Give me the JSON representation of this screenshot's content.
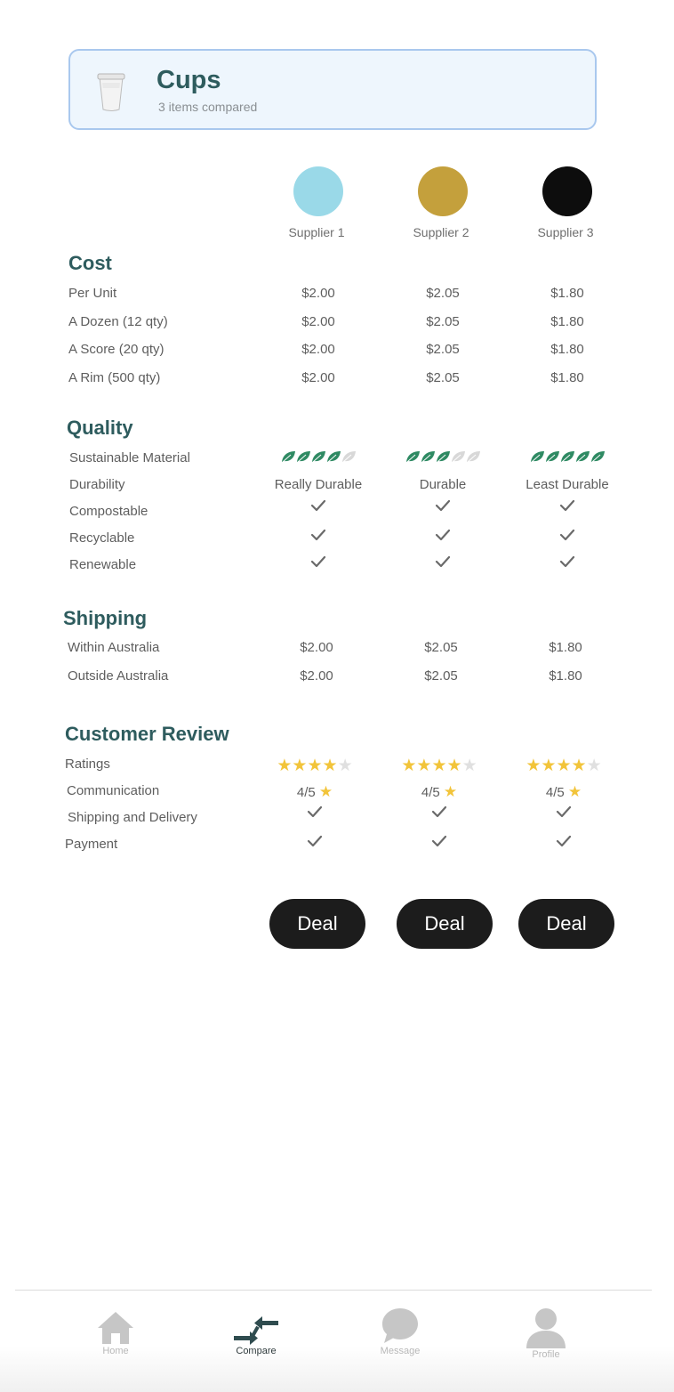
{
  "header": {
    "title": "Cups",
    "subtitle": "3 items compared",
    "icon": "cup-icon"
  },
  "suppliers": [
    {
      "name": "Supplier 1",
      "color": "#9ad9e8"
    },
    {
      "name": "Supplier 2",
      "color": "#c4a03c"
    },
    {
      "name": "Supplier 3",
      "color": "#0d0d0d"
    }
  ],
  "cost": {
    "title": "Cost",
    "rows": [
      {
        "label": "Per Unit",
        "values": [
          "$2.00",
          "$2.05",
          "$1.80"
        ]
      },
      {
        "label": "A Dozen (12 qty)",
        "values": [
          "$2.00",
          "$2.05",
          "$1.80"
        ]
      },
      {
        "label": "A Score (20 qty)",
        "values": [
          "$2.00",
          "$2.05",
          "$1.80"
        ]
      },
      {
        "label": "A Rim (500 qty)",
        "values": [
          "$2.00",
          "$2.05",
          "$1.80"
        ]
      }
    ]
  },
  "quality": {
    "title": "Quality",
    "sustainable": {
      "label": "Sustainable Material",
      "leaves": [
        4,
        3,
        5
      ],
      "max": 5,
      "leaf_color": "#2f8a63"
    },
    "durability": {
      "label": "Durability",
      "values": [
        "Really Durable",
        "Durable",
        "Least Durable"
      ]
    },
    "compostable": {
      "label": "Compostable",
      "values": [
        true,
        true,
        true
      ]
    },
    "recyclable": {
      "label": "Recyclable",
      "values": [
        true,
        true,
        true
      ]
    },
    "renewable": {
      "label": "Renewable",
      "values": [
        true,
        true,
        true
      ]
    }
  },
  "shipping": {
    "title": "Shipping",
    "rows": [
      {
        "label": "Within Australia",
        "values": [
          "$2.00",
          "$2.05",
          "$1.80"
        ]
      },
      {
        "label": "Outside Australia",
        "values": [
          "$2.00",
          "$2.05",
          "$1.80"
        ]
      }
    ]
  },
  "review": {
    "title": "Customer Review",
    "ratings": {
      "label": "Ratings",
      "stars": [
        4,
        4,
        4
      ],
      "max": 5
    },
    "communication": {
      "label": "Communication",
      "values": [
        "4/5",
        "4/5",
        "4/5"
      ]
    },
    "shipping_delivery": {
      "label": "Shipping and Delivery",
      "values": [
        true,
        true,
        true
      ]
    },
    "payment": {
      "label": "Payment",
      "values": [
        true,
        true,
        true
      ]
    }
  },
  "deal_buttons": [
    "Deal",
    "Deal",
    "Deal"
  ],
  "nav": {
    "items": [
      {
        "label": "Home",
        "icon": "home-icon",
        "active": false
      },
      {
        "label": "Compare",
        "icon": "compare-icon",
        "active": true
      },
      {
        "label": "Message",
        "icon": "message-icon",
        "active": false
      },
      {
        "label": "Profile",
        "icon": "profile-icon",
        "active": false
      }
    ]
  }
}
